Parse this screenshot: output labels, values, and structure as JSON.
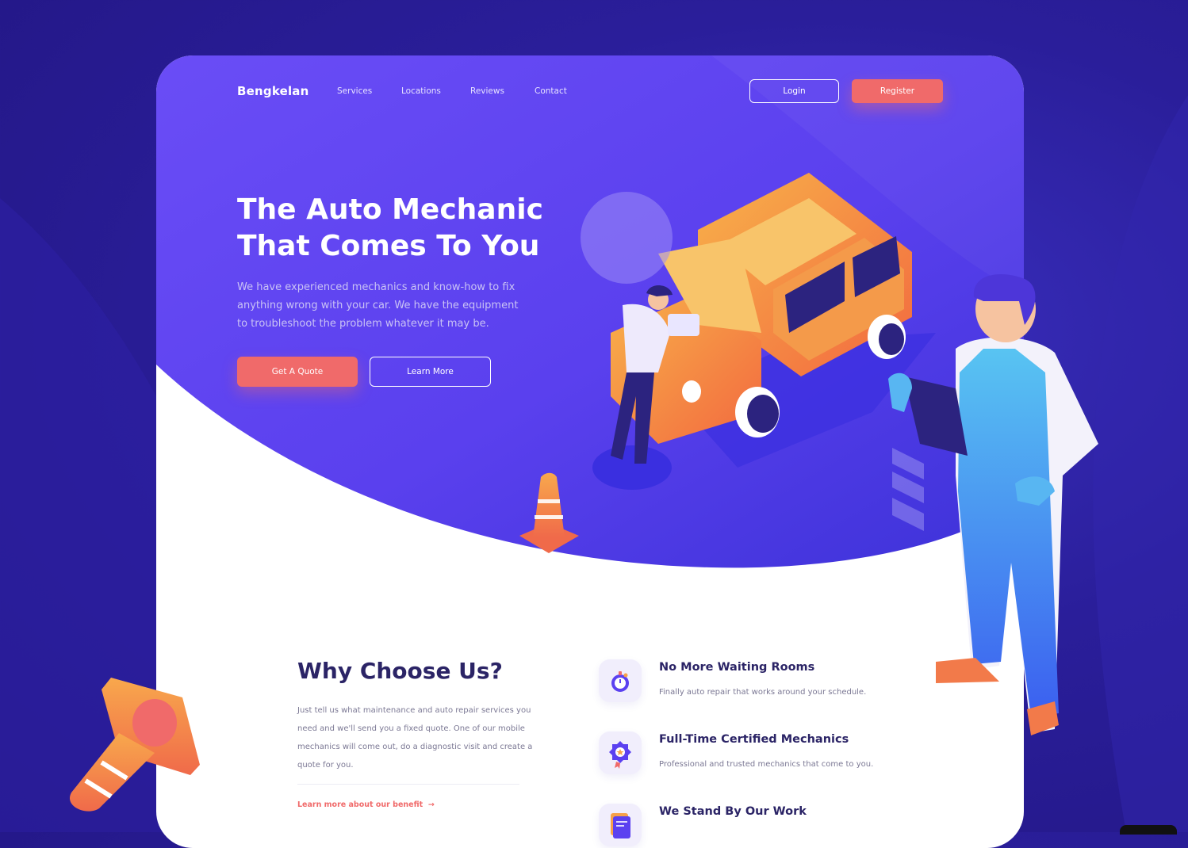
{
  "nav": {
    "brand": "Bengkelan",
    "links": [
      "Services",
      "Locations",
      "Reviews",
      "Contact"
    ],
    "login": "Login",
    "register": "Register"
  },
  "hero": {
    "title_line1": "The Auto Mechanic",
    "title_line2": "That Comes To You",
    "description": "We have experienced mechanics and know-how to fix anything wrong with your car. We have the equipment to troubleshoot the problem whatever it may be.",
    "cta_primary": "Get A Quote",
    "cta_secondary": "Learn More"
  },
  "why": {
    "title": "Why Choose Us?",
    "description": "Just tell us what maintenance and auto repair services you need and we'll send you a fixed quote. One of our mobile mechanics will come out, do a diagnostic visit and create a quote for you.",
    "link": "Learn more about our benefit"
  },
  "features": [
    {
      "title": "No More Waiting Rooms",
      "description": "Finally auto repair that works around your schedule.",
      "icon": "stopwatch-icon"
    },
    {
      "title": "Full-Time Certified Mechanics",
      "description": "Professional and trusted mechanics that come to you.",
      "icon": "certified-badge-icon"
    },
    {
      "title": "We Stand By Our Work",
      "description": "",
      "icon": "document-shield-icon"
    }
  ],
  "colors": {
    "primary": "#5b41f0",
    "accent": "#f06a6a",
    "background": "#2a1e9a",
    "heading": "#2b2466"
  }
}
